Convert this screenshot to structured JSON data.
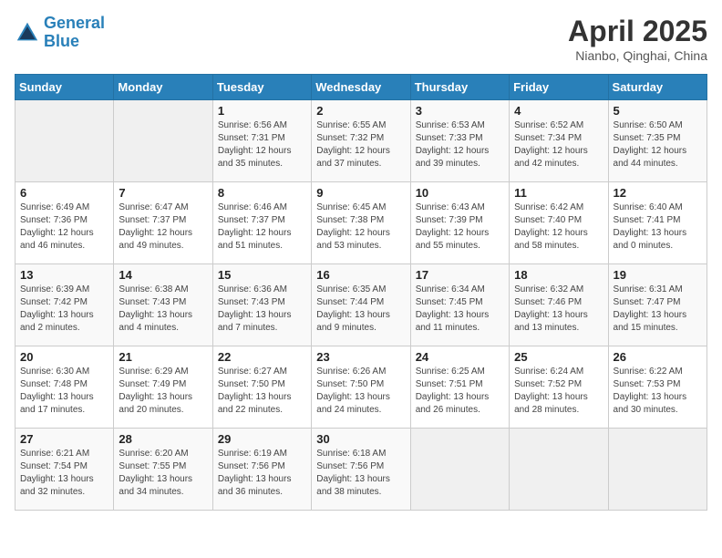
{
  "header": {
    "logo_line1": "General",
    "logo_line2": "Blue",
    "month_title": "April 2025",
    "location": "Nianbo, Qinghai, China"
  },
  "weekdays": [
    "Sunday",
    "Monday",
    "Tuesday",
    "Wednesday",
    "Thursday",
    "Friday",
    "Saturday"
  ],
  "weeks": [
    [
      {
        "day": "",
        "sunrise": "",
        "sunset": "",
        "daylight": ""
      },
      {
        "day": "",
        "sunrise": "",
        "sunset": "",
        "daylight": ""
      },
      {
        "day": "1",
        "sunrise": "Sunrise: 6:56 AM",
        "sunset": "Sunset: 7:31 PM",
        "daylight": "Daylight: 12 hours and 35 minutes."
      },
      {
        "day": "2",
        "sunrise": "Sunrise: 6:55 AM",
        "sunset": "Sunset: 7:32 PM",
        "daylight": "Daylight: 12 hours and 37 minutes."
      },
      {
        "day": "3",
        "sunrise": "Sunrise: 6:53 AM",
        "sunset": "Sunset: 7:33 PM",
        "daylight": "Daylight: 12 hours and 39 minutes."
      },
      {
        "day": "4",
        "sunrise": "Sunrise: 6:52 AM",
        "sunset": "Sunset: 7:34 PM",
        "daylight": "Daylight: 12 hours and 42 minutes."
      },
      {
        "day": "5",
        "sunrise": "Sunrise: 6:50 AM",
        "sunset": "Sunset: 7:35 PM",
        "daylight": "Daylight: 12 hours and 44 minutes."
      }
    ],
    [
      {
        "day": "6",
        "sunrise": "Sunrise: 6:49 AM",
        "sunset": "Sunset: 7:36 PM",
        "daylight": "Daylight: 12 hours and 46 minutes."
      },
      {
        "day": "7",
        "sunrise": "Sunrise: 6:47 AM",
        "sunset": "Sunset: 7:37 PM",
        "daylight": "Daylight: 12 hours and 49 minutes."
      },
      {
        "day": "8",
        "sunrise": "Sunrise: 6:46 AM",
        "sunset": "Sunset: 7:37 PM",
        "daylight": "Daylight: 12 hours and 51 minutes."
      },
      {
        "day": "9",
        "sunrise": "Sunrise: 6:45 AM",
        "sunset": "Sunset: 7:38 PM",
        "daylight": "Daylight: 12 hours and 53 minutes."
      },
      {
        "day": "10",
        "sunrise": "Sunrise: 6:43 AM",
        "sunset": "Sunset: 7:39 PM",
        "daylight": "Daylight: 12 hours and 55 minutes."
      },
      {
        "day": "11",
        "sunrise": "Sunrise: 6:42 AM",
        "sunset": "Sunset: 7:40 PM",
        "daylight": "Daylight: 12 hours and 58 minutes."
      },
      {
        "day": "12",
        "sunrise": "Sunrise: 6:40 AM",
        "sunset": "Sunset: 7:41 PM",
        "daylight": "Daylight: 13 hours and 0 minutes."
      }
    ],
    [
      {
        "day": "13",
        "sunrise": "Sunrise: 6:39 AM",
        "sunset": "Sunset: 7:42 PM",
        "daylight": "Daylight: 13 hours and 2 minutes."
      },
      {
        "day": "14",
        "sunrise": "Sunrise: 6:38 AM",
        "sunset": "Sunset: 7:43 PM",
        "daylight": "Daylight: 13 hours and 4 minutes."
      },
      {
        "day": "15",
        "sunrise": "Sunrise: 6:36 AM",
        "sunset": "Sunset: 7:43 PM",
        "daylight": "Daylight: 13 hours and 7 minutes."
      },
      {
        "day": "16",
        "sunrise": "Sunrise: 6:35 AM",
        "sunset": "Sunset: 7:44 PM",
        "daylight": "Daylight: 13 hours and 9 minutes."
      },
      {
        "day": "17",
        "sunrise": "Sunrise: 6:34 AM",
        "sunset": "Sunset: 7:45 PM",
        "daylight": "Daylight: 13 hours and 11 minutes."
      },
      {
        "day": "18",
        "sunrise": "Sunrise: 6:32 AM",
        "sunset": "Sunset: 7:46 PM",
        "daylight": "Daylight: 13 hours and 13 minutes."
      },
      {
        "day": "19",
        "sunrise": "Sunrise: 6:31 AM",
        "sunset": "Sunset: 7:47 PM",
        "daylight": "Daylight: 13 hours and 15 minutes."
      }
    ],
    [
      {
        "day": "20",
        "sunrise": "Sunrise: 6:30 AM",
        "sunset": "Sunset: 7:48 PM",
        "daylight": "Daylight: 13 hours and 17 minutes."
      },
      {
        "day": "21",
        "sunrise": "Sunrise: 6:29 AM",
        "sunset": "Sunset: 7:49 PM",
        "daylight": "Daylight: 13 hours and 20 minutes."
      },
      {
        "day": "22",
        "sunrise": "Sunrise: 6:27 AM",
        "sunset": "Sunset: 7:50 PM",
        "daylight": "Daylight: 13 hours and 22 minutes."
      },
      {
        "day": "23",
        "sunrise": "Sunrise: 6:26 AM",
        "sunset": "Sunset: 7:50 PM",
        "daylight": "Daylight: 13 hours and 24 minutes."
      },
      {
        "day": "24",
        "sunrise": "Sunrise: 6:25 AM",
        "sunset": "Sunset: 7:51 PM",
        "daylight": "Daylight: 13 hours and 26 minutes."
      },
      {
        "day": "25",
        "sunrise": "Sunrise: 6:24 AM",
        "sunset": "Sunset: 7:52 PM",
        "daylight": "Daylight: 13 hours and 28 minutes."
      },
      {
        "day": "26",
        "sunrise": "Sunrise: 6:22 AM",
        "sunset": "Sunset: 7:53 PM",
        "daylight": "Daylight: 13 hours and 30 minutes."
      }
    ],
    [
      {
        "day": "27",
        "sunrise": "Sunrise: 6:21 AM",
        "sunset": "Sunset: 7:54 PM",
        "daylight": "Daylight: 13 hours and 32 minutes."
      },
      {
        "day": "28",
        "sunrise": "Sunrise: 6:20 AM",
        "sunset": "Sunset: 7:55 PM",
        "daylight": "Daylight: 13 hours and 34 minutes."
      },
      {
        "day": "29",
        "sunrise": "Sunrise: 6:19 AM",
        "sunset": "Sunset: 7:56 PM",
        "daylight": "Daylight: 13 hours and 36 minutes."
      },
      {
        "day": "30",
        "sunrise": "Sunrise: 6:18 AM",
        "sunset": "Sunset: 7:56 PM",
        "daylight": "Daylight: 13 hours and 38 minutes."
      },
      {
        "day": "",
        "sunrise": "",
        "sunset": "",
        "daylight": ""
      },
      {
        "day": "",
        "sunrise": "",
        "sunset": "",
        "daylight": ""
      },
      {
        "day": "",
        "sunrise": "",
        "sunset": "",
        "daylight": ""
      }
    ]
  ]
}
